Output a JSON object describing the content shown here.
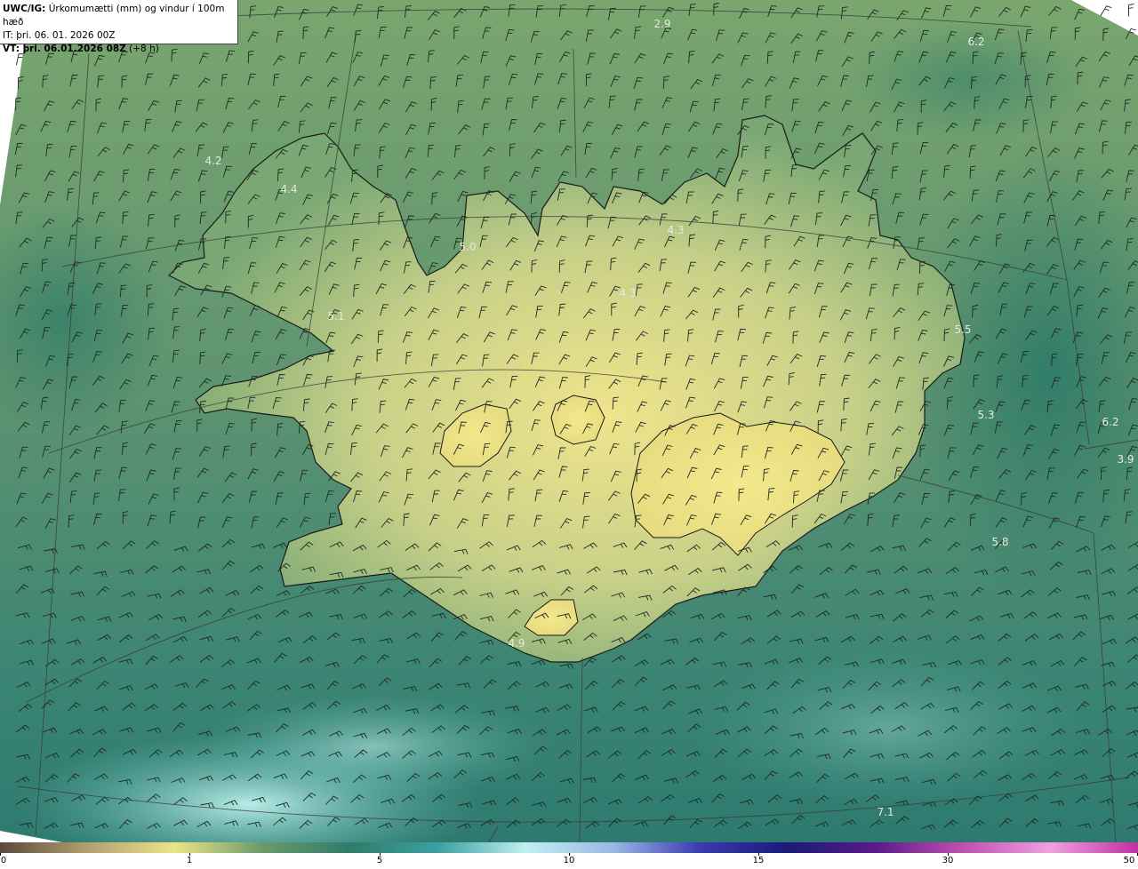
{
  "header": {
    "model_label": "UWC/IG:",
    "title_text": " Úrkomumætti (mm) og vindur í 100m hæð",
    "it_text": "IT: þri. 06. 01. 2026 00Z",
    "vt_label": "VT: þri. 06.01.2026 08Z",
    "vt_suffix": " (+8 h)"
  },
  "map": {
    "region": "Iceland",
    "values": [
      {
        "text": "2.9"
      },
      {
        "text": "6.2"
      },
      {
        "text": "4.2"
      },
      {
        "text": "4.4"
      },
      {
        "text": "5.0"
      },
      {
        "text": "4.3"
      },
      {
        "text": "5.1"
      },
      {
        "text": "4.3"
      },
      {
        "text": "5.5"
      },
      {
        "text": "5.3"
      },
      {
        "text": "6.2"
      },
      {
        "text": "3.9"
      },
      {
        "text": "5.8"
      },
      {
        "text": "4.9"
      },
      {
        "text": "7.1"
      }
    ]
  },
  "colorbar": {
    "ticks": [
      "0",
      "1",
      "5",
      "10",
      "15",
      "30",
      "50"
    ],
    "colors": [
      "#5a4a3a",
      "#b3a070",
      "#ece486",
      "#6a9a6a",
      "#2f7c6a",
      "#3aa0a0",
      "#bff0f0",
      "#9ab8e6",
      "#3a3ab0",
      "#1a1a7a",
      "#5a1a8a",
      "#c050b0",
      "#f0a0e0",
      "#c030a0"
    ]
  }
}
